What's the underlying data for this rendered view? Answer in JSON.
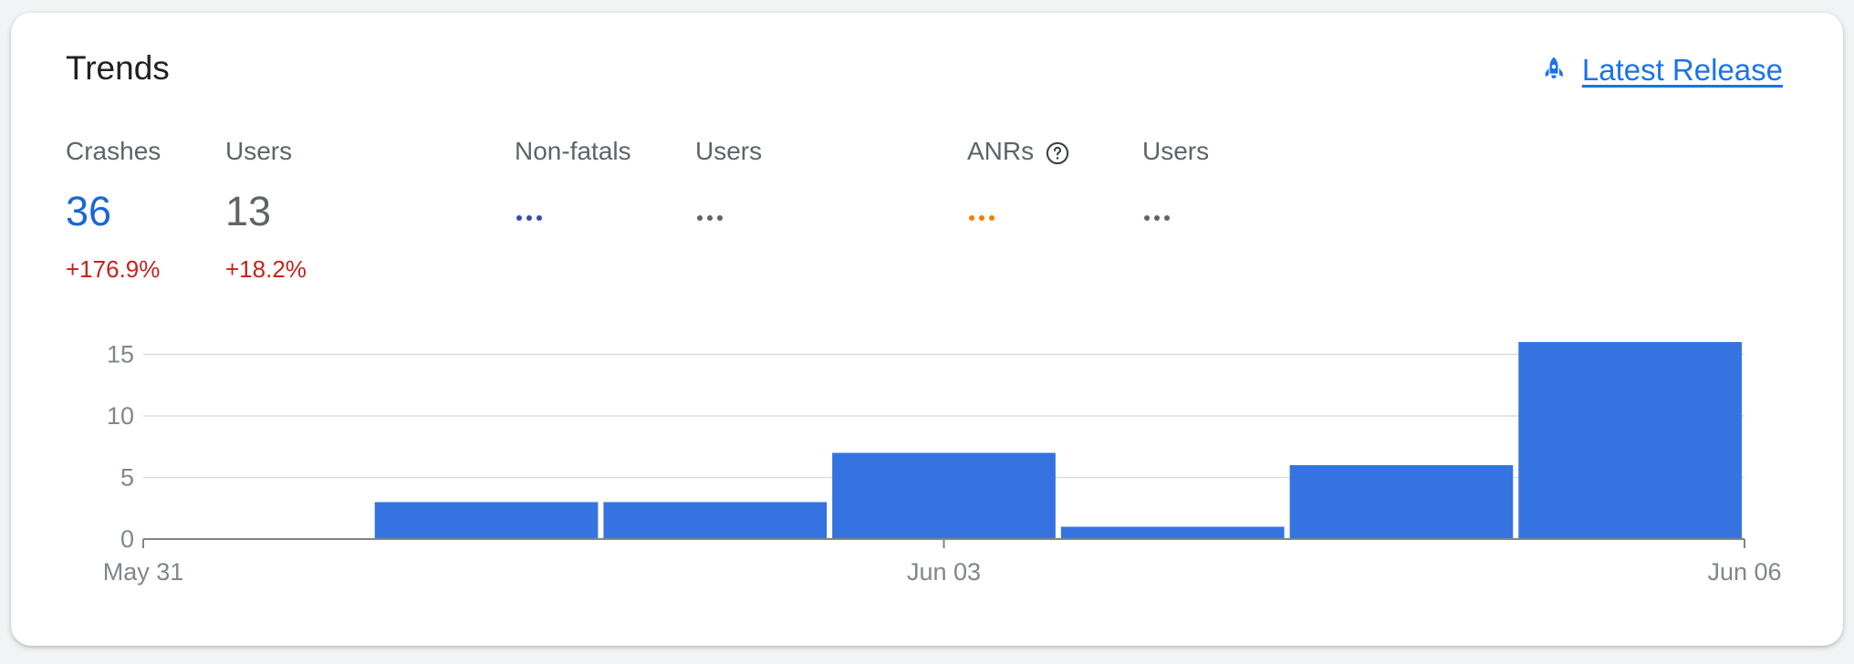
{
  "card": {
    "title": "Trends",
    "latest_release_label": "Latest Release",
    "latest_release_icon": "rocket-icon"
  },
  "metrics": {
    "crashes": {
      "label": "Crashes",
      "value": "36",
      "delta": "+176.9%"
    },
    "crash_users": {
      "label": "Users",
      "value": "13",
      "delta": "+18.2%"
    },
    "non_fatals": {
      "label": "Non-fatals",
      "loading_color": "#3949ab"
    },
    "non_fatal_users": {
      "label": "Users",
      "loading_color": "#5f6368"
    },
    "anrs": {
      "label": "ANRs",
      "icon": "help-icon",
      "loading_color": "#f57c00"
    },
    "anr_users": {
      "label": "Users",
      "loading_color": "#5f6368"
    }
  },
  "colors": {
    "accent": "#1a73e8",
    "bar": "#3574e0",
    "negative_delta": "#c5221f"
  },
  "chart_data": {
    "type": "bar",
    "categories": [
      "May 31",
      "Jun 01",
      "Jun 02",
      "Jun 03",
      "Jun 04",
      "Jun 05",
      "Jun 06"
    ],
    "values": [
      0,
      3,
      3,
      7,
      1,
      6,
      16
    ],
    "x_tick_labels": [
      "May 31",
      "Jun 03",
      "Jun 06"
    ],
    "y_ticks": [
      0,
      5,
      10,
      15
    ],
    "ylim": [
      0,
      16
    ],
    "grid": true,
    "title": "",
    "xlabel": "",
    "ylabel": ""
  }
}
